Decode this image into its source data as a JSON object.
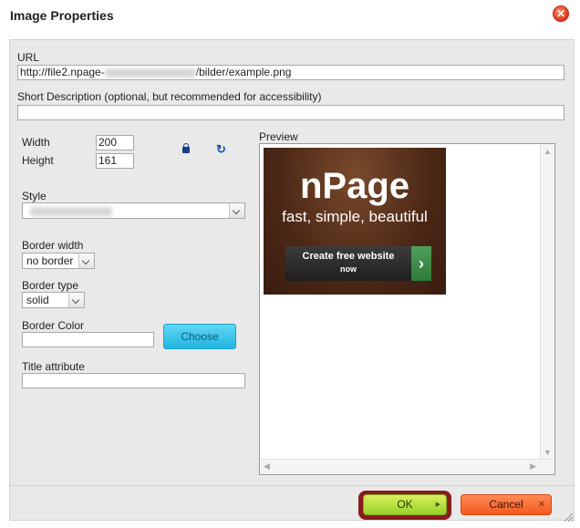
{
  "dialog": {
    "title": "Image Properties"
  },
  "url": {
    "label": "URL",
    "value_prefix": "http://file2.npage-",
    "value_suffix": "/bilder/example.png"
  },
  "short_description": {
    "label": "Short Description (optional, but recommended for accessibility)",
    "value": ""
  },
  "width": {
    "label": "Width",
    "value": "200"
  },
  "height": {
    "label": "Height",
    "value": "161"
  },
  "style": {
    "label": "Style",
    "value": ""
  },
  "border_width": {
    "label": "Border width",
    "value": "no border"
  },
  "border_type": {
    "label": "Border type",
    "value": "solid"
  },
  "border_color": {
    "label": "Border Color",
    "value": "",
    "choose_label": "Choose"
  },
  "title_attribute": {
    "label": "Title attribute",
    "value": ""
  },
  "preview": {
    "label": "Preview",
    "banner": {
      "headline": "nPage",
      "tagline": "fast, simple, beautiful",
      "cta_line1": "Create free website",
      "cta_line2": "now"
    }
  },
  "buttons": {
    "ok": "OK",
    "cancel": "Cancel"
  },
  "icons": {
    "close": "close-icon",
    "lock": "lock-icon",
    "reset": "reset-size-icon"
  },
  "colors": {
    "ok": "#b5e23a",
    "cancel": "#f56a2a",
    "choose": "#3cc4ea",
    "close": "#e8401f"
  }
}
